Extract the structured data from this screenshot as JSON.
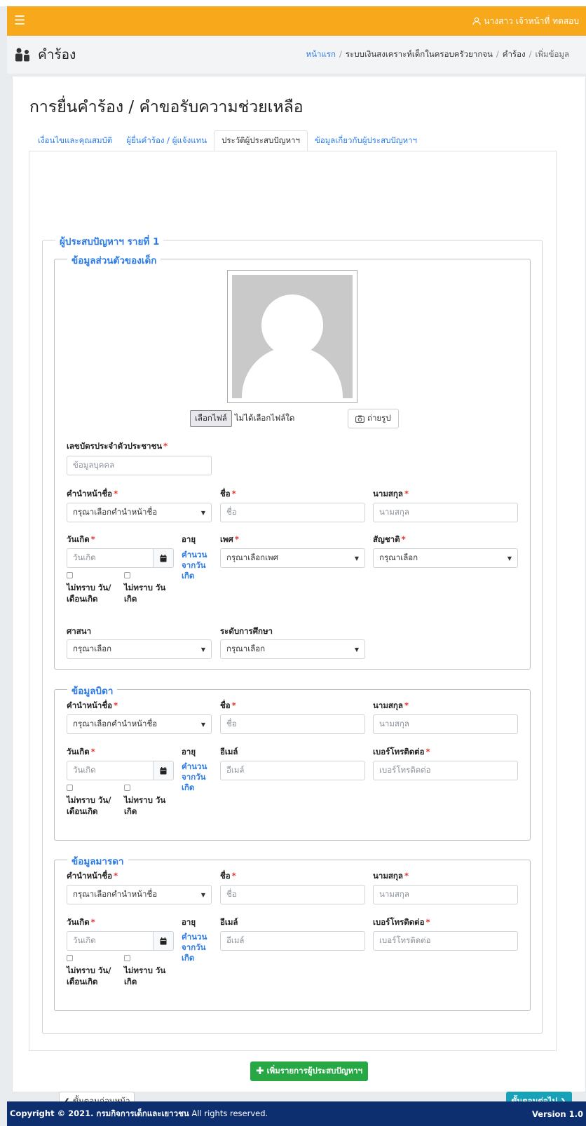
{
  "topbar": {
    "menu_icon": "hamburger-icon",
    "user_icon": "user-icon",
    "user_name": "นางสาว เจ้าหน้าที่ ทดสอบ"
  },
  "header": {
    "icon": "people-icon",
    "title": "คำร้อง",
    "breadcrumb": [
      "หน้าแรก",
      "ระบบเงินสงเคราะห์เด็กในครอบครัวยากจน",
      "คำร้อง",
      "เพิ่มข้อมูล"
    ]
  },
  "page_title": "การยื่นคำร้อง / คำขอรับความช่วยเหลือ",
  "tabs": [
    {
      "label": "เงื่อนไขและคุณสมบัติ"
    },
    {
      "label": "ผู้ยื่นคำร้อง / ผู้แจ้งแทน"
    },
    {
      "label": "ประวัติผู้ประสบปัญหาฯ"
    },
    {
      "label": "ข้อมูลเกี่ยวกับผู้ประสบปัญหาฯ"
    }
  ],
  "victim": {
    "legend": "ผู้ประสบปัญหาฯ รายที่ 1",
    "child": {
      "legend": "ข้อมูลส่วนตัวของเด็ก",
      "file_button": "เลือกไฟล์",
      "file_status": "ไม่ได้เลือกไฟล์ใด",
      "camera_icon": "camera-icon",
      "snap_button": "ถ่ายรูป",
      "id_label": "เลขบัตรประจำตัวประชาชน",
      "id_placeholder": "ข้อมูลบุคคล",
      "prefix_label": "คำนำหน้าชื่อ",
      "prefix_value": "กรุณาเลือกคำนำหน้าชื่อ",
      "first_label": "ชื่อ",
      "first_placeholder": "ชื่อ",
      "last_label": "นามสกุล",
      "last_placeholder": "นามสกุล",
      "dob_label": "วันเกิด",
      "dob_placeholder": "วันเกิด",
      "unknown_daymonth": "ไม่ทราบ วัน/ เดือนเกิด",
      "unknown_day": "ไม่ทราบ วัน เกิด",
      "age_label": "อายุ",
      "age_calc": "คำนวน จากวัน เกิด",
      "gender_label": "เพศ",
      "gender_value": "กรุณาเลือกเพศ",
      "nationality_label": "สัญชาติ",
      "nationality_value": "กรุณาเลือก",
      "religion_label": "ศาสนา",
      "religion_value": "กรุณาเลือก",
      "education_label": "ระดับการศึกษา",
      "education_value": "กรุณาเลือก"
    },
    "father": {
      "legend": "ข้อมูลบิดา",
      "prefix_label": "คำนำหน้าชื่อ",
      "prefix_value": "กรุณาเลือกคำนำหน้าชื่อ",
      "first_label": "ชื่อ",
      "first_placeholder": "ชื่อ",
      "last_label": "นามสกุล",
      "last_placeholder": "นามสกุล",
      "dob_label": "วันเกิด",
      "dob_placeholder": "วันเกิด",
      "unknown_daymonth": "ไม่ทราบ วัน/ เดือนเกิด",
      "unknown_day": "ไม่ทราบ วัน เกิด",
      "age_label": "อายุ",
      "age_calc": "คำนวน จากวัน เกิด",
      "email_label": "อีเมล์",
      "email_placeholder": "อีเมล์",
      "phone_label": "เบอร์โทรติดต่อ",
      "phone_placeholder": "เบอร์โทรติดต่อ"
    },
    "mother": {
      "legend": "ข้อมูลมารดา",
      "prefix_label": "คำนำหน้าชื่อ",
      "prefix_value": "กรุณาเลือกคำนำหน้าชื่อ",
      "first_label": "ชื่อ",
      "first_placeholder": "ชื่อ",
      "last_label": "นามสกุล",
      "last_placeholder": "นามสกุล",
      "dob_label": "วันเกิด",
      "dob_placeholder": "วันเกิด",
      "unknown_daymonth": "ไม่ทราบ วัน/ เดือนเกิด",
      "unknown_day": "ไม่ทราบ วัน เกิด",
      "age_label": "อายุ",
      "age_calc": "คำนวน จากวัน เกิด",
      "email_label": "อีเมล์",
      "email_placeholder": "อีเมล์",
      "phone_label": "เบอร์โทรติดต่อ",
      "phone_placeholder": "เบอร์โทรติดต่อ"
    }
  },
  "actions": {
    "add_victim": "เพิ่มรายการผู้ประสบปัญหาฯ",
    "prev": "ขั้นตอนก่อนหน้า",
    "next": "ขั้นตอนต่อไป"
  },
  "footer": {
    "copyright": "Copyright © 2021. กรมกิจการเด็กและเยาวชน",
    "rights": "All rights reserved.",
    "version": "Version 1.0"
  },
  "colors": {
    "topbar": "#f7a81b",
    "link": "#2c7be5",
    "required": "#e3342f",
    "add_button": "#28a745",
    "next_button": "#17a2b8",
    "footer": "#0d2e6f"
  }
}
